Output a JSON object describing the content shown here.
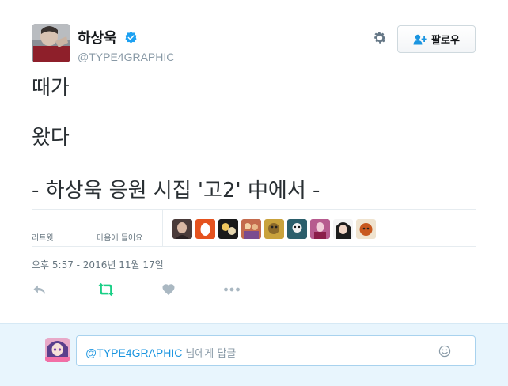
{
  "colors": {
    "accent": "#1b95e0",
    "verified": "#1da1f2",
    "retweet_green": "#19cf86",
    "muted": "#8899a6",
    "reply_bg": "#e8f5fd"
  },
  "author": {
    "display_name": "하상욱",
    "handle": "@TYPE4GRAPHIC",
    "verified_icon": "verified-badge-icon",
    "avatar_icon": "profile-avatar"
  },
  "header_actions": {
    "settings_icon": "gear-icon",
    "follow_icon": "follow-person-icon",
    "follow_label": "팔로우"
  },
  "tweet": {
    "text_lines": [
      "때가",
      "왔다",
      "- 하상욱 응원 시집 '고2' 中에서 -"
    ],
    "timestamp": "오후 5:57 - 2016년 11월 17일"
  },
  "stats": {
    "retweets_label": "리트윗",
    "likes_label": "마음에 들어요",
    "liker_avatars": [
      "liker-1",
      "liker-2",
      "liker-3",
      "liker-4",
      "liker-5",
      "liker-6",
      "liker-7",
      "liker-8",
      "liker-9"
    ]
  },
  "actions": [
    {
      "name": "reply-icon"
    },
    {
      "name": "retweet-icon"
    },
    {
      "name": "heart-icon"
    },
    {
      "name": "more-icon"
    }
  ],
  "reply": {
    "mention": "@TYPE4GRAPHIC",
    "placeholder": "님에게 답글",
    "emoji_icon": "emoji-icon"
  }
}
